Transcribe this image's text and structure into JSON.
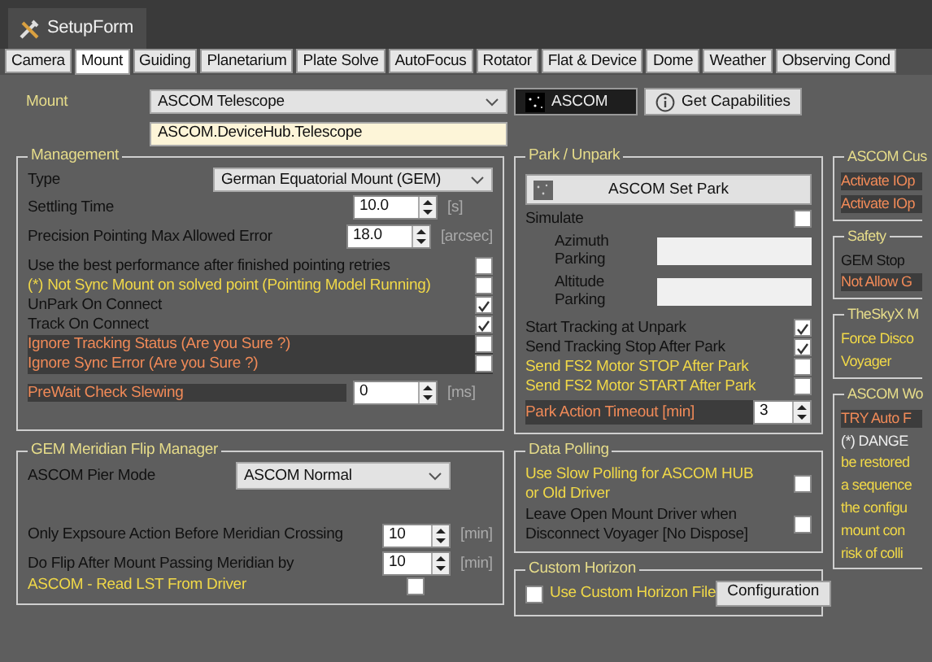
{
  "window": {
    "title": "SetupForm"
  },
  "tabs": [
    {
      "label": "Camera",
      "selected": false
    },
    {
      "label": "Mount",
      "selected": true
    },
    {
      "label": "Guiding",
      "selected": false
    },
    {
      "label": "Planetarium",
      "selected": false
    },
    {
      "label": "Plate Solve",
      "selected": false
    },
    {
      "label": "AutoFocus",
      "selected": false
    },
    {
      "label": "Rotator",
      "selected": false
    },
    {
      "label": "Flat & Device",
      "selected": false
    },
    {
      "label": "Dome",
      "selected": false
    },
    {
      "label": "Weather",
      "selected": false
    },
    {
      "label": "Observing Cond",
      "selected": false
    }
  ],
  "mount": {
    "label": "Mount",
    "driver": "ASCOM Telescope",
    "device": "ASCOM.DeviceHub.Telescope",
    "ascom_button": "ASCOM",
    "capabilities_button": "Get Capabilities"
  },
  "management": {
    "title": "Management",
    "type_label": "Type",
    "type_value": "German Equatorial Mount (GEM)",
    "spinners": [
      {
        "label": "Settling Time",
        "value": "10.0",
        "unit": "[s]"
      },
      {
        "label": "Precision Pointing Max Allowed Error",
        "value": "18.0",
        "unit": "[arcsec]"
      }
    ],
    "options": [
      {
        "label": "Use the best performance after finished pointing retries",
        "checked": false,
        "kind": "normal"
      },
      {
        "label": "(*) Not Sync Mount on solved point (Pointing Model Running)",
        "checked": false,
        "kind": "warning"
      },
      {
        "label": "UnPark On Connect",
        "checked": true,
        "kind": "normal"
      },
      {
        "label": "Track On Connect",
        "checked": true,
        "kind": "normal"
      },
      {
        "label": "Ignore Tracking Status (Are you Sure ?)",
        "checked": false,
        "kind": "danger"
      },
      {
        "label": "Ignore Sync Error (Are you Sure ?)",
        "checked": false,
        "kind": "danger"
      }
    ],
    "prewait": {
      "label": "PreWait Check Slewing",
      "value": "0",
      "unit": "[ms]"
    }
  },
  "meridian_flip": {
    "title": "GEM Meridian Flip Manager",
    "pier_label": "ASCOM Pier Mode",
    "pier_value": "ASCOM Normal",
    "spinners": [
      {
        "label": "Only Expsoure Action Before Meridian Crossing",
        "value": "10",
        "unit": "[min]"
      },
      {
        "label": "Do Flip After Mount Passing Meridian by",
        "value": "10",
        "unit": "[min]"
      }
    ],
    "options": [
      {
        "label": "ASCOM - Read LST From Driver",
        "checked": false,
        "kind": "warning"
      }
    ]
  },
  "park": {
    "title": "Park / Unpark",
    "button": "ASCOM Set Park",
    "simulate": {
      "label": "Simulate",
      "checked": false
    },
    "fields": [
      "Azimuth Parking",
      "Altitude Parking"
    ],
    "options": [
      {
        "label": "Start Tracking at Unpark",
        "checked": true,
        "kind": "normal"
      },
      {
        "label": "Send Tracking Stop After Park",
        "checked": true,
        "kind": "normal"
      },
      {
        "label": "Send FS2 Motor STOP After Park",
        "checked": false,
        "kind": "warning"
      },
      {
        "label": "Send FS2 Motor START After Park",
        "checked": false,
        "kind": "warning"
      }
    ],
    "timeout": {
      "label": "Park Action Timeout [min]",
      "value": "3"
    }
  },
  "data_polling": {
    "title": "Data Polling",
    "options": [
      {
        "label": "Use Slow Polling for ASCOM HUB or Old Driver",
        "checked": false,
        "kind": "warning"
      },
      {
        "label": "Leave Open Mount Driver when Disconnect Voyager [No Dispose]",
        "checked": false,
        "kind": "normal"
      }
    ]
  },
  "custom_horizon": {
    "title": "Custom Horizon",
    "option": {
      "label": "Use Custom Horizon File",
      "checked": false
    },
    "button": "Configuration"
  },
  "right_panels": [
    {
      "title": "ASCOM Cus",
      "lines": [
        {
          "text": "Activate IOp",
          "kind": "danger"
        },
        {
          "text": "Activate IOp",
          "kind": "danger"
        }
      ]
    },
    {
      "title": "Safety",
      "lines": [
        {
          "text": "GEM Stop",
          "kind": "normal"
        },
        {
          "text": "Not Allow G",
          "kind": "danger"
        }
      ]
    },
    {
      "title": "TheSkyX M",
      "lines": [
        {
          "text": "Force Disco",
          "kind": "warning"
        },
        {
          "text": "Voyager",
          "kind": "warning"
        }
      ]
    },
    {
      "title": "ASCOM Wo",
      "lines": [
        {
          "text": "TRY Auto F",
          "kind": "danger"
        },
        {
          "text": "(*) DANGE",
          "kind": "light"
        },
        {
          "text": "be restored",
          "kind": "warning"
        },
        {
          "text": "a sequence",
          "kind": "warning"
        },
        {
          "text": "the configu",
          "kind": "warning"
        },
        {
          "text": "mount con",
          "kind": "warning"
        },
        {
          "text": "risk of colli",
          "kind": "warning"
        }
      ]
    }
  ]
}
